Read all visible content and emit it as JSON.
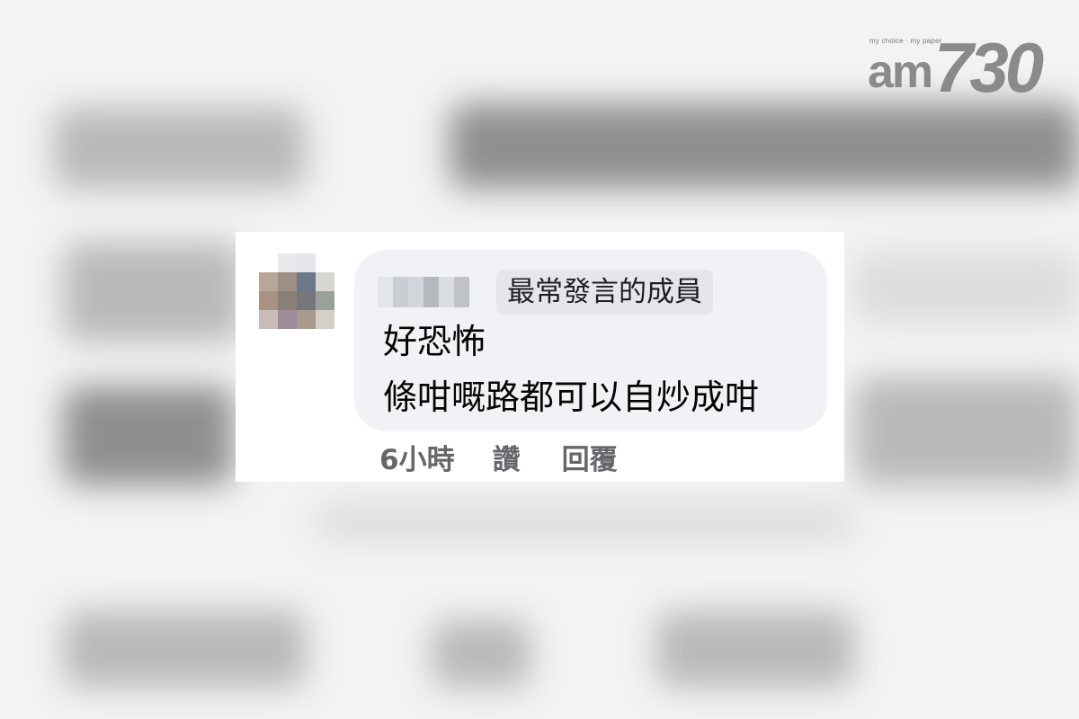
{
  "logo": {
    "slogan": "my choice · my paper",
    "am": "am",
    "number": "730"
  },
  "comment": {
    "author_badge": "最常發言的成員",
    "text_line_1": "好恐怖",
    "text_line_2": "條咁嘅路都可以自炒成咁",
    "timestamp": "6小時",
    "like_label": "讚",
    "reply_label": "回覆"
  },
  "colors": {
    "bubble_bg": "#f0f2f5",
    "badge_bg": "#e4e6eb",
    "meta_text": "#65676b",
    "body_text": "#050505"
  }
}
